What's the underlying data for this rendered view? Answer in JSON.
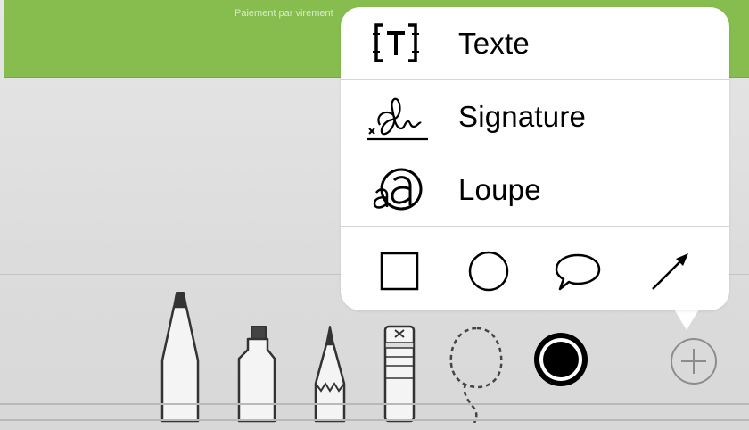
{
  "document": {
    "strip_text": "Paiement par virement",
    "strip_color": "#86bd4e"
  },
  "menu": {
    "items": [
      {
        "label": "Texte",
        "icon": "text-box-icon"
      },
      {
        "label": "Signature",
        "icon": "signature-icon"
      },
      {
        "label": "Loupe",
        "icon": "magnifier-loupe-icon"
      }
    ],
    "shapes": [
      {
        "icon": "square-shape-icon"
      },
      {
        "icon": "circle-shape-icon"
      },
      {
        "icon": "speech-bubble-shape-icon"
      },
      {
        "icon": "arrow-shape-icon"
      }
    ]
  },
  "toolbar": {
    "tools": [
      {
        "icon": "pen-icon"
      },
      {
        "icon": "highlighter-icon"
      },
      {
        "icon": "pencil-icon"
      },
      {
        "icon": "eraser-icon"
      },
      {
        "icon": "lasso-icon"
      },
      {
        "icon": "color-picker-icon",
        "selected_color": "#000000"
      },
      {
        "icon": "add-icon"
      }
    ]
  }
}
